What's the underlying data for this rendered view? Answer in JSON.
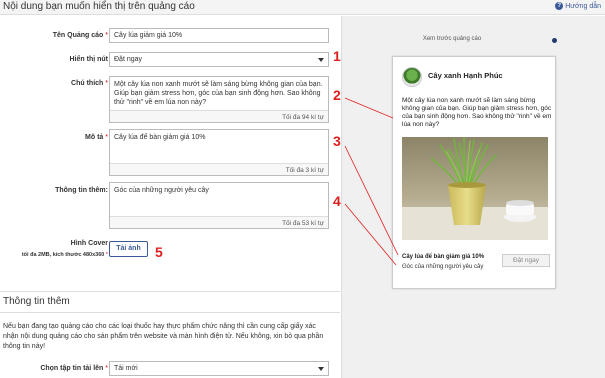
{
  "header": {
    "title": "Nội dung bạn muốn hiển thị trên quảng cáo",
    "help_icon": "?",
    "help_label": "Hướng dẫn"
  },
  "form": {
    "ad_name": {
      "label": "Tên Quảng cáo",
      "required": "*",
      "value": "Cây lúa giảm giá 10%"
    },
    "show_button": {
      "label": "Hiển thị nút",
      "value": "Đặt ngay"
    },
    "caption": {
      "label": "Chú thích",
      "required": "*",
      "value": "Một cây lúa non xanh mướt sẽ làm sáng bừng không gian của bạn. Giúp bạn giảm stress hơn, góc của bạn sinh động hơn. Sao không thử \"rinh\" về em lúa non này?",
      "counter": "Tối đa 94 kí tự"
    },
    "description": {
      "label": "Mô tả",
      "required": "*",
      "value": "Cây lúa để bàn giảm giá 10%",
      "counter": "Tối đa 3 kí tự"
    },
    "more_info": {
      "label": "Thông tin thêm:",
      "value": "Góc của những người yêu cây",
      "counter": "Tối đa 53 kí tự"
    },
    "cover": {
      "label": "Hình Cover",
      "note": "tối đa 2MB, kích thước 480x360",
      "required": "*",
      "button": "Tải ảnh"
    }
  },
  "section": {
    "title": "Thông tin thêm",
    "text": "Nếu bạn đang tạo quảng cáo cho các loại thuốc hay thực phẩm chức năng thì cần cung cấp giấy xác nhận nội dung quảng cáo cho sản phẩm trên website và màn hình điện tử. Nếu không, xin bỏ qua phần thông tin này!",
    "file_label": "Chọn tập tin tải lên",
    "file_required": "*",
    "file_value": "Tải mới"
  },
  "markers": [
    "1",
    "2",
    "3",
    "4",
    "5"
  ],
  "preview": {
    "label": "Xem trước quảng cáo",
    "page_name": "Cây xanh Hạnh Phúc",
    "body": "Một cây lúa non xanh mướt sẽ làm sáng bừng không gian của bạn. Giúp bạn giảm stress hơn, góc của bạn sinh động hơn. Sao không thử \"rinh\" về em lúa non này?",
    "headline": "Cây lúa để bàn giảm giá 10%",
    "desc": "Góc của những người yêu cây",
    "cta": "Đặt ngay"
  },
  "colors": {
    "marker": "#e02020",
    "link": "#3b5998",
    "required": "#dd0000"
  }
}
